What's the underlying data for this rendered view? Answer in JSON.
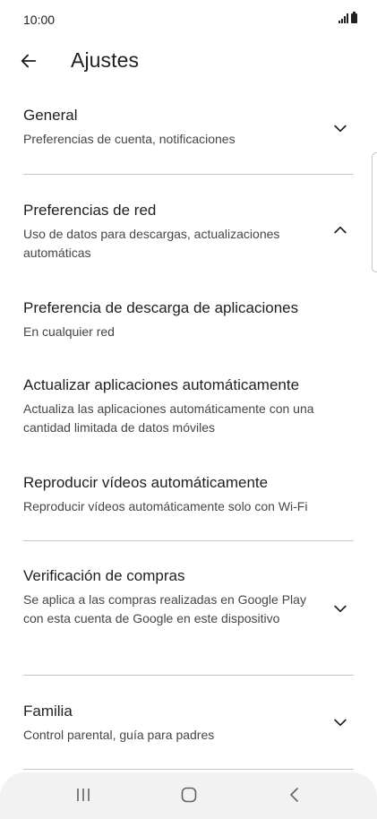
{
  "status": {
    "time": "10:00",
    "signal_icon": "signal-bars-icon",
    "battery_icon": "battery-icon"
  },
  "app_bar": {
    "back_icon": "arrow-back-icon",
    "title": "Ajustes"
  },
  "sections": {
    "general": {
      "title": "General",
      "subtitle": "Preferencias de cuenta, notificaciones",
      "expanded": false
    },
    "network": {
      "title": "Preferencias de red",
      "subtitle": "Uso de datos para descargas, actualizaciones automáticas",
      "expanded": true,
      "items": [
        {
          "title": "Preferencia de descarga de aplicaciones",
          "subtitle": "En cualquier red"
        },
        {
          "title": "Actualizar aplicaciones automáticamente",
          "subtitle": "Actualiza las aplicaciones automáticamente con una cantidad limitada de datos móviles"
        },
        {
          "title": "Reproducir vídeos automáticamente",
          "subtitle": "Reproducir vídeos automáticamente solo con Wi-Fi"
        }
      ]
    },
    "purchase": {
      "title": "Verificación de compras",
      "subtitle": "Se aplica a las compras realizadas en Google Play con esta cuenta de Google en este dispositivo",
      "expanded": false
    },
    "family": {
      "title": "Familia",
      "subtitle": "Control parental, guía para padres",
      "expanded": false
    }
  },
  "nav_bar": {
    "recents_icon": "recent-apps-icon",
    "home_icon": "home-icon",
    "back_icon": "nav-back-icon"
  },
  "colors": {
    "text_primary": "#1f1f1f",
    "text_secondary": "#444746",
    "divider": "#c4c7c5",
    "nav_background": "#f2f2f2"
  }
}
